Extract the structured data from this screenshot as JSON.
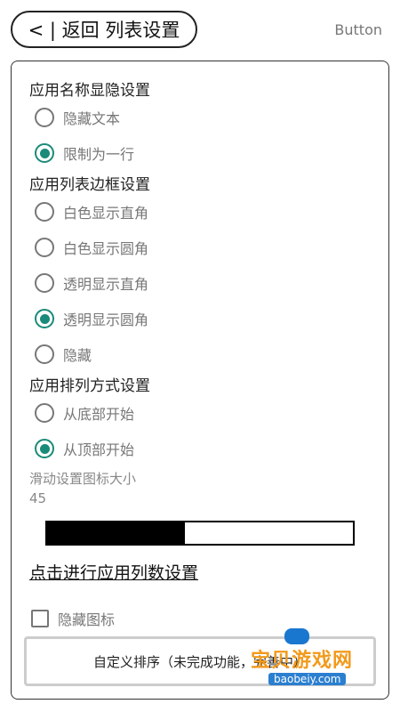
{
  "topbar": {
    "back_label": "< | 返回  列表设置",
    "right_label": "Button"
  },
  "name_section": {
    "title": "应用名称显隐设置",
    "options": [
      {
        "label": "隐藏文本",
        "selected": false
      },
      {
        "label": "限制为一行",
        "selected": true
      }
    ]
  },
  "border_section": {
    "title": "应用列表边框设置",
    "options": [
      {
        "label": "白色显示直角",
        "selected": false
      },
      {
        "label": "白色显示圆角",
        "selected": false
      },
      {
        "label": "透明显示直角",
        "selected": false
      },
      {
        "label": "透明显示圆角",
        "selected": true
      },
      {
        "label": "隐藏",
        "selected": false
      }
    ]
  },
  "order_section": {
    "title": "应用排列方式设置",
    "options": [
      {
        "label": "从底部开始",
        "selected": false
      },
      {
        "label": "从顶部开始",
        "selected": true
      }
    ]
  },
  "slider": {
    "title": "滑动设置图标大小",
    "value": "45",
    "fraction": 0.45
  },
  "columns_link": "点击进行应用列数设置",
  "hide_icon": {
    "label": "隐藏图标",
    "checked": false
  },
  "sort_button": "自定义排序（未完成功能，完善中）",
  "watermark": {
    "text": "宝贝游戏网",
    "url": "baobeiy.com"
  },
  "colors": {
    "accent": "#1a8a7a"
  }
}
